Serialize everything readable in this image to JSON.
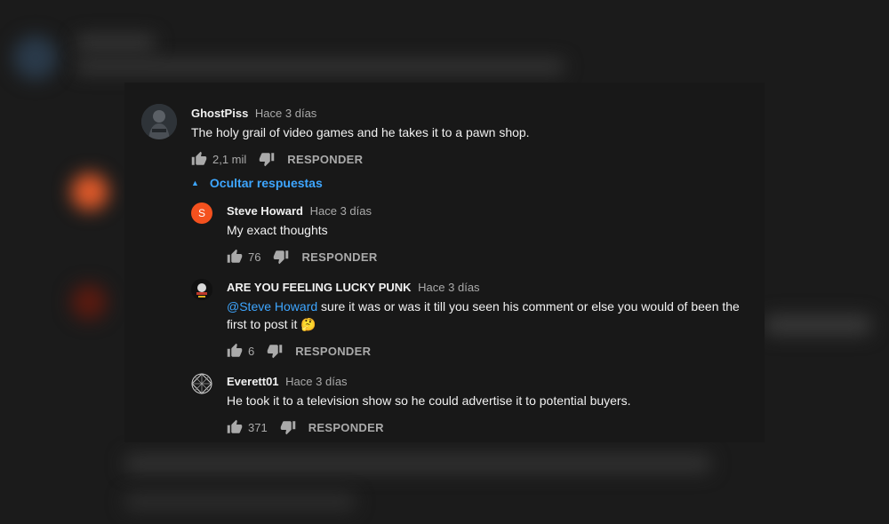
{
  "comments": {
    "main": {
      "author": "GhostPiss",
      "time": "Hace 3 días",
      "text": "The holy grail of video games and he takes it to a pawn shop.",
      "likes": "2,1 mil",
      "reply_label": "RESPONDER"
    },
    "toggle_label": "Ocultar respuestas",
    "replies": [
      {
        "author": "Steve Howard",
        "time": "Hace 3 días",
        "avatar_letter": "S",
        "avatar_color": "#f4511e",
        "text": "My exact thoughts",
        "likes": "76",
        "reply_label": "RESPONDER"
      },
      {
        "author": "ARE YOU FEELING LUCKY PUNK",
        "time": "Hace 3 días",
        "mention": "@Steve Howard",
        "text": " sure it was or was it till you seen his comment or else you would of been the first to post it 🤔",
        "likes": "6",
        "reply_label": "RESPONDER"
      },
      {
        "author": "Everett01",
        "time": "Hace 3 días",
        "text": "He took it to a television show so he could advertise it to potential buyers.",
        "likes": "371",
        "reply_label": "RESPONDER"
      }
    ]
  },
  "colors": {
    "link": "#3ea6ff",
    "text": "#f1f1f1",
    "muted": "#aaaaaa",
    "card_bg": "#181818"
  }
}
